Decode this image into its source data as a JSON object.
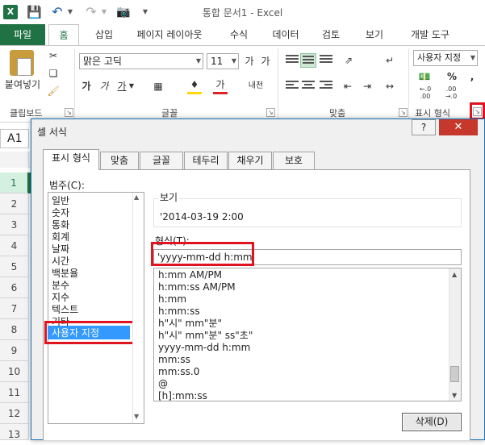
{
  "titlebar": {
    "excel_icon": "X",
    "save_icon": "save-icon",
    "undo_icon": "undo-icon",
    "redo_icon": "redo-icon",
    "camera_icon": "camera-icon",
    "title": "통합 문서1 - Excel"
  },
  "ribbon": {
    "file_tab": "파일",
    "tabs": [
      "홈",
      "삽입",
      "페이지 레이아웃",
      "수식",
      "데이터",
      "검토",
      "보기",
      "개발 도구"
    ],
    "clipboard": {
      "paste_label": "붙여넣기",
      "group_label": "클립보드"
    },
    "font": {
      "font_name": "맑은 고딕",
      "font_size": "11",
      "grow": "가",
      "shrink": "가",
      "bold": "가",
      "italic": "가",
      "underline": "가",
      "font_color": "가",
      "phonetic": "내천",
      "group_label": "글꼴"
    },
    "alignment": {
      "group_label": "맞춤"
    },
    "number": {
      "format": "사용자 지정",
      "group_label": "표시 형식",
      "percent": "%",
      "comma": ",",
      "increase_decimal": "←.0\n.00",
      "decrease_decimal": ".00\n→.0"
    }
  },
  "formula_bar": {
    "name_box": "A1"
  },
  "grid": {
    "rows": [
      "1",
      "2",
      "3",
      "4",
      "5",
      "6",
      "7",
      "8",
      "9",
      "10",
      "11",
      "12",
      "13"
    ]
  },
  "dialog": {
    "title": "셀 서식",
    "help": "?",
    "close": "✕",
    "tabs": [
      "표시 형식",
      "맞춤",
      "글꼴",
      "테두리",
      "채우기",
      "보호"
    ],
    "category_label": "범주(C):",
    "categories": [
      "일반",
      "숫자",
      "통화",
      "회계",
      "날짜",
      "시간",
      "백분율",
      "분수",
      "지수",
      "텍스트",
      "기타",
      "사용자 지정"
    ],
    "selected_category": "사용자 지정",
    "sample_label": "보기",
    "sample_value": "'2014-03-19 2:00",
    "type_label": "형식(T):",
    "type_value": "'yyyy-mm-dd h:mm",
    "formats": [
      "h:mm AM/PM",
      "h:mm:ss AM/PM",
      "h:mm",
      "h:mm:ss",
      "h\"시\" mm\"분\"",
      "h\"시\" mm\"분\" ss\"초\"",
      "yyyy-mm-dd h:mm",
      "mm:ss",
      "mm:ss.0",
      "@",
      "[h]:mm:ss"
    ],
    "delete_button": "삭제(D)"
  },
  "colors": {
    "excel_green": "#207245",
    "highlight_red": "#e0141e",
    "selection_blue": "#3399ff",
    "close_red": "#c7382c"
  }
}
